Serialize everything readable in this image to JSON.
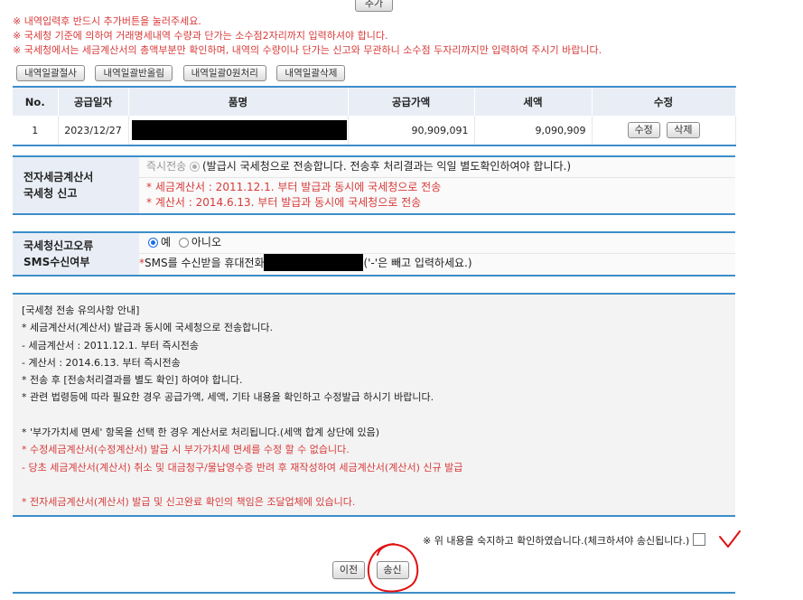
{
  "top": {
    "add_label": "추가"
  },
  "notices": [
    "※ 내역입력후 반드시 추가버튼을 눌러주세요.",
    "※ 국세청 기준에 의하여 거래명세내역 수량과 단가는 소수점2자리까지 입력하셔야 합니다.",
    "※ 국세청에서는 세금계산서의 총액부분만 확인하며, 내역의 수량이나 단가는 신고와 무관하니 소수점 두자리까지만 입력하여 주시기 바랍니다."
  ],
  "batch_buttons": [
    "내역일괄절사",
    "내역일괄반올림",
    "내역일괄0원처리",
    "내역일괄삭제"
  ],
  "items_table": {
    "headers": [
      "No.",
      "공급일자",
      "품명",
      "공급가액",
      "세액",
      "수정"
    ],
    "rows": [
      {
        "no": "1",
        "date": "2023/12/27",
        "item_name": "",
        "supply_amount": "90,909,091",
        "tax": "9,090,909",
        "edit_label": "수정",
        "delete_label": "삭제"
      }
    ]
  },
  "nts_report": {
    "label_line1": "전자세금계산서",
    "label_line2": "국세청 신고",
    "immediate_label": "즉시전송",
    "immediate_desc": "(발급시 국세청으로 전송합니다. 전송후 처리결과는 익일 별도확인하여야 합니다.)",
    "rule1": "* 세금계산서 : 2011.12.1. 부터 발급과 동시에 국세청으로 전송",
    "rule2": "* 계산서 : 2014.6.13. 부터 발급과 동시에 국세청으로 전송"
  },
  "sms": {
    "label_line1": "국세청신고오류",
    "label_line2": "SMS수신여부",
    "yes_label": "예",
    "no_label": "아니오",
    "selected": "예",
    "required_mark": "*",
    "phone_prompt": "SMS를 수신받을 휴대전화 번호",
    "phone_hint": "('-'은 빼고 입력하세요.)"
  },
  "guide": {
    "lines": [
      {
        "text": "[국세청 전송 유의사항 안내]",
        "red": false
      },
      {
        "text": "* 세금계산서(계산서) 발급과 동시에 국세청으로 전송합니다.",
        "red": false
      },
      {
        "text": "- 세금계산서 : 2011.12.1. 부터 즉시전송",
        "red": false
      },
      {
        "text": "- 계산서 : 2014.6.13. 부터 즉시전송",
        "red": false
      },
      {
        "text": "* 전송 후 [전송처리결과를 별도 확인] 하여야 합니다.",
        "red": false
      },
      {
        "text": "* 관련 법령등에 따라 필요한 경우 공급가액, 세액, 기타 내용을 확인하고 수정발급 하시기 바랍니다.",
        "red": false
      },
      {
        "text": "",
        "red": false
      },
      {
        "text": "* '부가가치세 면세' 항목을 선택 한 경우 계산서로 처리됩니다.(세액 합계 상단에 있음)",
        "red": false
      },
      {
        "text": "* 수정세금계산서(수정계산서) 발급 시 부가가치세 면세를 수정 할 수 없습니다.",
        "red": true
      },
      {
        "text": "- 당초 세금계산서(계산서) 취소 및 대금청구/물납영수증 반려 후 재작성하여 세금계산서(계산서) 신규 발급",
        "red": true
      },
      {
        "text": "",
        "red": false
      },
      {
        "text": "* 전자세금계산서(계산서) 발급 및 신고완료 확인의 책임은 조달업체에 있습니다.",
        "red": true
      }
    ]
  },
  "agree": {
    "text": "※ 위 내용을 숙지하고 확인하였습니다.(체크하셔야 송신됩니다.)",
    "checked": false
  },
  "actions": {
    "prev_label": "이전",
    "send_label": "송신"
  },
  "colors": {
    "accent": "#3d8ec9",
    "notice_red": "#d83a3a",
    "annotation_red": "#e01010"
  }
}
